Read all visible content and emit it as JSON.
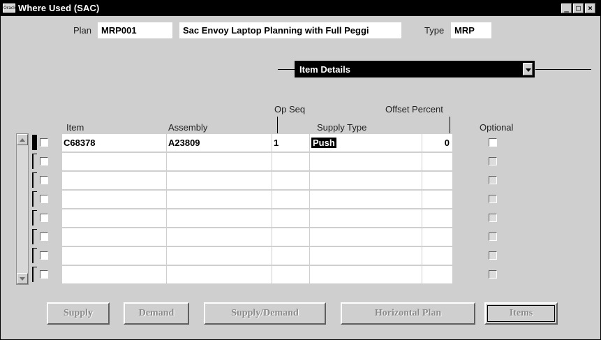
{
  "window": {
    "title": "Where Used (SAC)",
    "icon_label": "Oracle",
    "controls": [
      "minimize",
      "maximize",
      "close"
    ]
  },
  "header": {
    "plan_label": "Plan",
    "plan_value": "MRP001",
    "plan_desc": "Sac Envoy Laptop Planning with Full Peggi",
    "type_label": "Type",
    "type_value": "MRP"
  },
  "region_select": {
    "value": "Item Details"
  },
  "columns": {
    "item": "Item",
    "assembly": "Assembly",
    "op_seq": "Op Seq",
    "supply_type": "Supply Type",
    "offset_percent": "Offset Percent",
    "optional": "Optional"
  },
  "rows": [
    {
      "item": "C68378",
      "assembly": "A23809",
      "op_seq": "1",
      "supply_type": "Push",
      "offset_percent": "0"
    },
    {
      "item": "",
      "assembly": "",
      "op_seq": "",
      "supply_type": "",
      "offset_percent": ""
    },
    {
      "item": "",
      "assembly": "",
      "op_seq": "",
      "supply_type": "",
      "offset_percent": ""
    },
    {
      "item": "",
      "assembly": "",
      "op_seq": "",
      "supply_type": "",
      "offset_percent": ""
    },
    {
      "item": "",
      "assembly": "",
      "op_seq": "",
      "supply_type": "",
      "offset_percent": ""
    },
    {
      "item": "",
      "assembly": "",
      "op_seq": "",
      "supply_type": "",
      "offset_percent": ""
    },
    {
      "item": "",
      "assembly": "",
      "op_seq": "",
      "supply_type": "",
      "offset_percent": ""
    },
    {
      "item": "",
      "assembly": "",
      "op_seq": "",
      "supply_type": "",
      "offset_percent": ""
    }
  ],
  "buttons": {
    "supply": "Supply",
    "demand": "Demand",
    "supply_demand": "Supply/Demand",
    "horizontal_plan": "Horizontal Plan",
    "items": "Items"
  }
}
